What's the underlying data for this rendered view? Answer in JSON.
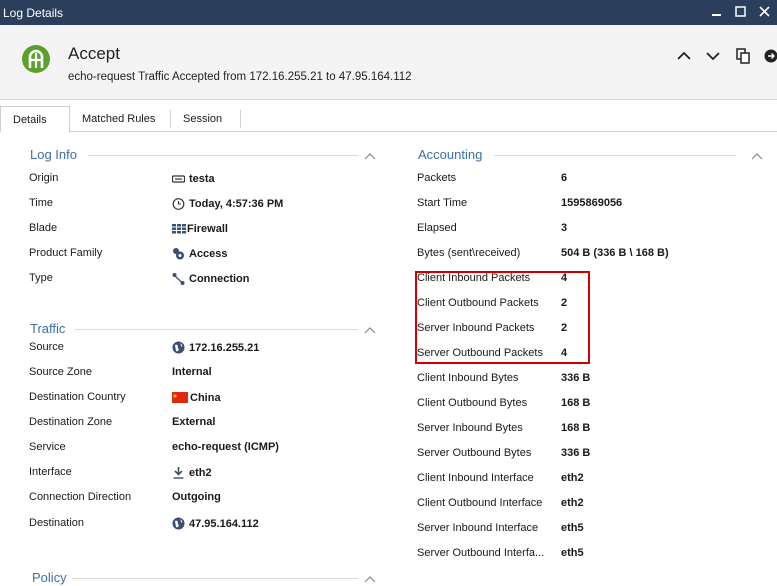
{
  "window": {
    "title": "Log Details"
  },
  "header": {
    "title": "Accept",
    "subtitle": "echo-request Traffic Accepted from 172.16.255.21 to 47.95.164.112"
  },
  "tabs": [
    "Details",
    "Matched Rules",
    "Session"
  ],
  "log_info": {
    "title": "Log Info",
    "rows": [
      {
        "label": "Origin",
        "value": "testa",
        "icon": "gateway-icon"
      },
      {
        "label": "Time",
        "value": "Today, 4:57:36 PM",
        "icon": "clock-icon"
      },
      {
        "label": "Blade",
        "value": "Firewall",
        "icon": "firewall-icon"
      },
      {
        "label": "Product Family",
        "value": "Access",
        "icon": "access-icon"
      },
      {
        "label": "Type",
        "value": "Connection",
        "icon": "connection-icon"
      }
    ]
  },
  "traffic": {
    "title": "Traffic",
    "rows": [
      {
        "label": "Source",
        "value": "172.16.255.21",
        "icon": "globe-icon"
      },
      {
        "label": "Source Zone",
        "value": "Internal"
      },
      {
        "label": "Destination Country",
        "value": "China",
        "icon": "china-flag-icon"
      },
      {
        "label": "Destination Zone",
        "value": "External"
      },
      {
        "label": "Service",
        "value": "echo-request (ICMP)"
      },
      {
        "label": "Interface",
        "value": "eth2",
        "icon": "download-arrow-icon"
      },
      {
        "label": "Connection Direction",
        "value": "Outgoing"
      },
      {
        "label": "Destination",
        "value": "47.95.164.112",
        "icon": "globe-icon"
      }
    ]
  },
  "policy": {
    "title": "Policy"
  },
  "accounting": {
    "title": "Accounting",
    "rows": [
      {
        "label": "Packets",
        "value": "6"
      },
      {
        "label": "Start Time",
        "value": "1595869056"
      },
      {
        "label": "Elapsed",
        "value": "3"
      },
      {
        "label": "Bytes (sent\\received)",
        "value": "504 B (336 B \\ 168 B)"
      },
      {
        "label": "Client Inbound Packets",
        "value": "4"
      },
      {
        "label": "Client Outbound Packets",
        "value": "2"
      },
      {
        "label": "Server Inbound Packets",
        "value": "2"
      },
      {
        "label": "Server Outbound Packets",
        "value": "4"
      },
      {
        "label": "Client Inbound Bytes",
        "value": "336 B"
      },
      {
        "label": "Client Outbound Bytes",
        "value": "168 B"
      },
      {
        "label": "Server Inbound Bytes",
        "value": "168 B"
      },
      {
        "label": "Server Outbound Bytes",
        "value": "336 B"
      },
      {
        "label": "Client Inbound Interface",
        "value": "eth2"
      },
      {
        "label": "Client Outbound Interface",
        "value": "eth2"
      },
      {
        "label": "Server Inbound Interface",
        "value": "eth5"
      },
      {
        "label": "Server Outbound Interfa...",
        "value": "eth5"
      }
    ]
  },
  "colors": {
    "accent": "#3d6fa6",
    "titlebar": "#2b3f5c",
    "accept_green": "#5aa02c",
    "highlight": "#d40000"
  }
}
